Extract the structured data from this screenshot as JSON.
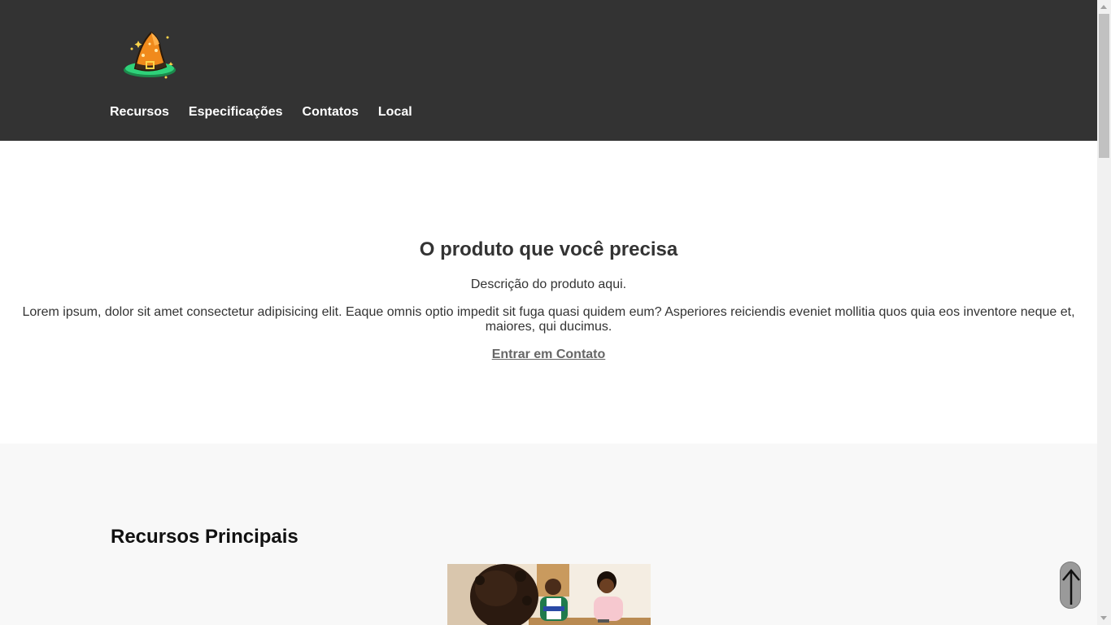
{
  "header": {
    "logo_icon": "wizard-hat-logo-icon",
    "nav": [
      {
        "label": "Recursos"
      },
      {
        "label": "Especificações"
      },
      {
        "label": "Contatos"
      },
      {
        "label": "Local"
      }
    ],
    "background_color": "#333333"
  },
  "hero": {
    "title": "O produto que você precisa",
    "subtitle": "Descrição do produto aqui.",
    "text": "Lorem ipsum, dolor sit amet consectetur adipisicing elit. Eaque omnis optio impedit sit fuga quasi quidem eum? Asperiores reiciendis eveniet mollitia quos quia eos inventore neque et, maiores, qui ducimus.",
    "cta_label": "Entrar em Contato"
  },
  "features": {
    "title": "Recursos Principais",
    "image_icon": "team-meeting-photo"
  },
  "back_to_top": {
    "icon": "arrow-up-icon"
  },
  "colors": {
    "header_bg": "#333333",
    "features_bg": "#f8f8f8",
    "cta": "#666666"
  }
}
